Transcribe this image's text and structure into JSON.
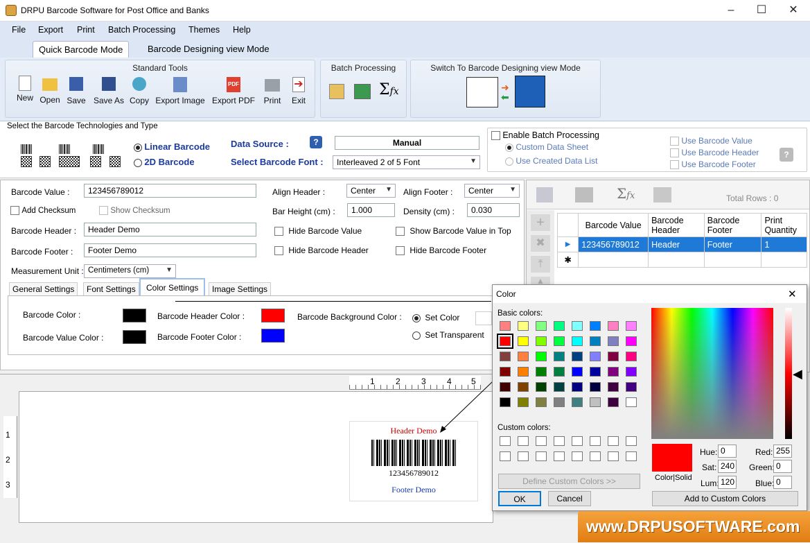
{
  "window": {
    "title": "DRPU Barcode Software for Post Office and Banks",
    "minimize": "–",
    "maximize": "☐",
    "close": "✕"
  },
  "menu": [
    "File",
    "Export",
    "Print",
    "Batch Processing",
    "Themes",
    "Help"
  ],
  "mode_tabs": {
    "quick": "Quick Barcode Mode",
    "designing": "Barcode Designing view Mode"
  },
  "ribbon": {
    "standard_title": "Standard Tools",
    "tools": [
      {
        "label": "New",
        "icon": "new-icon"
      },
      {
        "label": "Open",
        "icon": "open-icon"
      },
      {
        "label": "Save",
        "icon": "save-icon"
      },
      {
        "label": "Save As",
        "icon": "save-as-icon"
      },
      {
        "label": "Copy",
        "icon": "copy-icon"
      },
      {
        "label": "Export Image",
        "icon": "export-image-icon"
      },
      {
        "label": "Export PDF",
        "icon": "export-pdf-icon"
      },
      {
        "label": "Print",
        "icon": "print-icon"
      },
      {
        "label": "Exit",
        "icon": "exit-icon"
      }
    ],
    "batch_title": "Batch Processing",
    "switch_title": "Switch To Barcode Designing view Mode"
  },
  "tech": {
    "title": "Select the Barcode Technologies and Type",
    "linear": "Linear Barcode",
    "twod": "2D Barcode",
    "data_source_label": "Data Source :",
    "data_source_value": "Manual",
    "font_label": "Select Barcode Font :",
    "font_value": "Interleaved 2 of 5 Font",
    "enable_batch": "Enable Batch Processing",
    "custom_sheet": "Custom Data Sheet",
    "created_list": "Use Created Data List",
    "use_value": "Use Barcode Value",
    "use_header": "Use Barcode Header",
    "use_footer": "Use Barcode Footer",
    "help": "?"
  },
  "form": {
    "value_label": "Barcode Value :",
    "value": "123456789012",
    "add_checksum": "Add Checksum",
    "show_checksum": "Show Checksum",
    "header_label": "Barcode Header :",
    "header": "Header Demo",
    "footer_label": "Barcode Footer :",
    "footer": "Footer Demo",
    "unit_label": "Measurement Unit :",
    "unit": "Centimeters (cm)",
    "align_header_label": "Align Header :",
    "align_header": "Center",
    "align_footer_label": "Align Footer :",
    "align_footer": "Center",
    "bar_height_label": "Bar Height (cm) :",
    "bar_height": "1.000",
    "density_label": "Density (cm) :",
    "density": "0.030",
    "hide_value": "Hide Barcode Value",
    "show_value_top": "Show Barcode Value in Top",
    "hide_header": "Hide Barcode Header",
    "hide_footer": "Hide Barcode Footer"
  },
  "settings_tabs": [
    "General Settings",
    "Font Settings",
    "Color Settings",
    "Image Settings"
  ],
  "colors": {
    "barcode_color_label": "Barcode Color :",
    "barcode_value_color_label": "Barcode Value Color :",
    "header_color_label": "Barcode Header Color :",
    "footer_color_label": "Barcode Footer Color :",
    "bg_color_label": "Barcode Background Color :",
    "set_color": "Set Color",
    "set_transparent": "Set Transparent",
    "barcode": "#000000",
    "value": "#000000",
    "header": "#ff0000",
    "footer": "#0000ff"
  },
  "grid": {
    "total_rows": "Total Rows : 0",
    "headers": [
      "Barcode Value",
      "Barcode Header",
      "Barcode Footer",
      "Print Quantity"
    ],
    "rows": [
      [
        "123456789012",
        "Header",
        "Footer",
        "1"
      ]
    ]
  },
  "preview": {
    "header": "Header Demo",
    "value": "123456789012",
    "footer": "Footer Demo",
    "ruler_h": [
      "1",
      "2",
      "3",
      "4",
      "5"
    ],
    "ruler_v": [
      "1",
      "2",
      "3"
    ]
  },
  "dialog": {
    "title": "Color",
    "basic": "Basic colors:",
    "custom": "Custom colors:",
    "define": "Define Custom Colors >>",
    "ok": "OK",
    "cancel": "Cancel",
    "add": "Add to Custom Colors",
    "color_solid": "Color|Solid",
    "hue_label": "Hue:",
    "hue": "0",
    "sat_label": "Sat:",
    "sat": "240",
    "lum_label": "Lum:",
    "lum": "120",
    "red_label": "Red:",
    "red": "255",
    "green_label": "Green:",
    "green": "0",
    "blue_label": "Blue:",
    "blue": "0",
    "basic_colors": [
      "#ff8080",
      "#ffff80",
      "#80ff80",
      "#00ff80",
      "#80ffff",
      "#0080ff",
      "#ff80c0",
      "#ff80ff",
      "#ff0000",
      "#ffff00",
      "#80ff00",
      "#00ff40",
      "#00ffff",
      "#0080c0",
      "#8080c0",
      "#ff00ff",
      "#804040",
      "#ff8040",
      "#00ff00",
      "#008080",
      "#004080",
      "#8080ff",
      "#800040",
      "#ff0080",
      "#800000",
      "#ff8000",
      "#008000",
      "#008040",
      "#0000ff",
      "#0000a0",
      "#800080",
      "#8000ff",
      "#400000",
      "#804000",
      "#004000",
      "#004040",
      "#000080",
      "#000040",
      "#400040",
      "#400080",
      "#000000",
      "#808000",
      "#808040",
      "#808080",
      "#408080",
      "#c0c0c0",
      "#400040",
      "#ffffff"
    ]
  },
  "brand": "www.DRPUSOFTWARE.com"
}
